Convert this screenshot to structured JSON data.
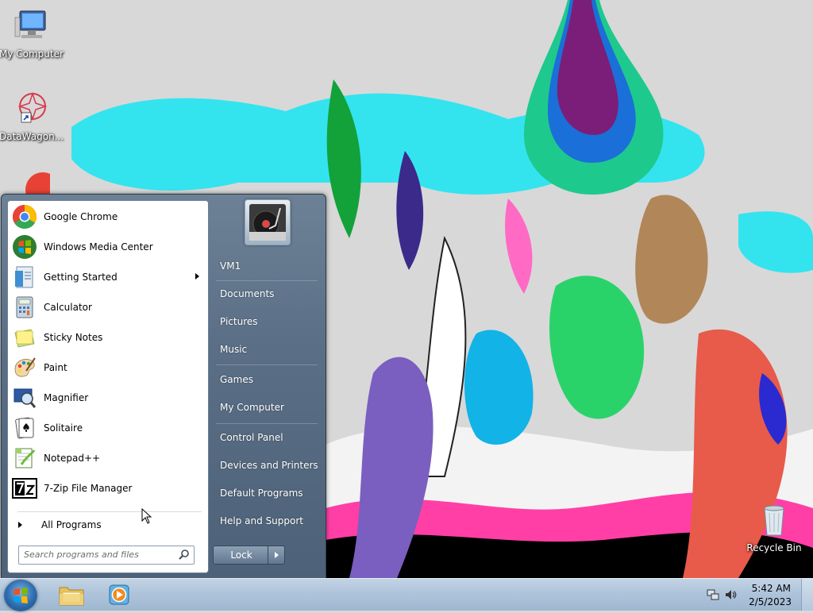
{
  "desktop": {
    "icons": [
      {
        "label": "My Computer",
        "icon": "computer-icon"
      },
      {
        "label": "DataWagon...",
        "icon": "datawagon-shortcut-icon"
      },
      {
        "label": "Recycle Bin",
        "icon": "recycle-bin-icon"
      }
    ]
  },
  "start_menu": {
    "programs": [
      {
        "label": "Google Chrome",
        "icon": "chrome-icon"
      },
      {
        "label": "Windows Media Center",
        "icon": "media-center-icon"
      },
      {
        "label": "Getting Started",
        "icon": "getting-started-icon",
        "has_submenu": true
      },
      {
        "label": "Calculator",
        "icon": "calculator-icon"
      },
      {
        "label": "Sticky Notes",
        "icon": "sticky-notes-icon"
      },
      {
        "label": "Paint",
        "icon": "paint-icon"
      },
      {
        "label": "Magnifier",
        "icon": "magnifier-icon"
      },
      {
        "label": "Solitaire",
        "icon": "solitaire-icon"
      },
      {
        "label": "Notepad++",
        "icon": "notepadpp-icon"
      },
      {
        "label": "7-Zip File Manager",
        "icon": "7zip-icon"
      }
    ],
    "all_programs_label": "All Programs",
    "search_placeholder": "Search programs and files",
    "right_items": [
      {
        "label": "VM1"
      },
      {
        "label": "Documents"
      },
      {
        "label": "Pictures"
      },
      {
        "label": "Music"
      },
      {
        "label": "Games"
      },
      {
        "label": "My Computer"
      },
      {
        "label": "Control Panel"
      },
      {
        "label": "Devices and Printers"
      },
      {
        "label": "Default Programs"
      },
      {
        "label": "Help and Support"
      }
    ],
    "lock_label": "Lock"
  },
  "taskbar": {
    "pinned": [
      {
        "icon": "windows-explorer-icon"
      },
      {
        "icon": "media-player-icon"
      }
    ],
    "tray_icons": [
      "network-icon",
      "volume-icon"
    ],
    "time": "5:42 AM",
    "date": "2/5/2023"
  },
  "colors": {
    "start_menu_right": "#5a6f86",
    "taskbar": "#aec4db",
    "wallpaper_cyan": "#33e4ef"
  }
}
